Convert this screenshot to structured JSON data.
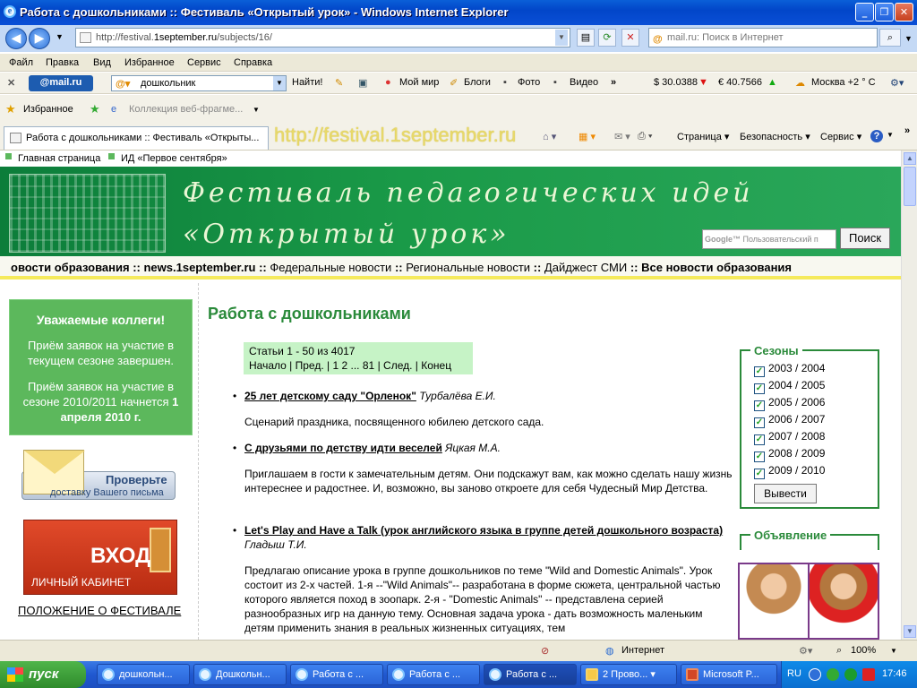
{
  "window": {
    "title": "Работа с дошкольниками :: Фестиваль «Открытый урок» - Windows Internet Explorer"
  },
  "address": {
    "url_prefix": "http://festival.",
    "url_domain": "1september.ru",
    "url_path": "/subjects/16/",
    "search_placeholder": "mail.ru: Поиск в Интернет"
  },
  "menu": [
    "Файл",
    "Правка",
    "Вид",
    "Избранное",
    "Сервис",
    "Справка"
  ],
  "mailbar": {
    "logo": "@mail.ru",
    "query": "дошкольник",
    "find": "Найти!",
    "links": [
      "Мой мир",
      "Блоги",
      "Фото",
      "Видео"
    ],
    "usd": "$ 30.0388",
    "eur": "€ 40.7566",
    "weather": "Москва +2 ° C"
  },
  "favbar": {
    "favorites": "Избранное",
    "gallery": "Коллекция веб-фрагме..."
  },
  "tabs": {
    "active_tab": "Работа с дошкольниками :: Фестиваль «Открыты...",
    "overlay_url": "http://festival.1september.ru",
    "commands": [
      "Страница",
      "Безопасность",
      "Сервис"
    ]
  },
  "page": {
    "topnav": [
      "Главная страница",
      "ИД «Первое сентября»"
    ],
    "banner": {
      "line1": "Фестиваль педагогических идей",
      "line2": "«Открытый урок»",
      "google_placeholder": "Пользовательский п",
      "search_button": "Поиск"
    },
    "newsbar": {
      "items": [
        "овости образования",
        "news.1september.ru",
        "Федеральные новости",
        "Региональные новости",
        "Дайджест СМИ",
        "Все новости образования"
      ],
      "sep": " :: "
    },
    "left": {
      "greeting": "Уважаемые коллеги!",
      "closed": "Приём заявок на участие в текущем сезоне завершен.",
      "next_prefix": "Приём заявок на участие в сезоне 2010/2011 начнется ",
      "next_date": "1 апреля 2010 г.",
      "envelope_l1": "Проверьте",
      "envelope_l2": "доставку Вашего письма",
      "login_title": "ВХОД",
      "login_sub": "ЛИЧНЫЙ КАБИНЕТ",
      "regulation": "ПОЛОЖЕНИЕ О ФЕСТИВАЛЕ"
    },
    "main": {
      "title": "Работа с дошкольниками",
      "pager": {
        "summary": "Статьи 1 - 50 из 4017",
        "start": "Начало",
        "prev": "Пред.",
        "current": "1",
        "next_page": "2",
        "dots": "...",
        "last_page": "81",
        "next": "След.",
        "end": "Конец"
      },
      "articles": [
        {
          "title": "25 лет детскому саду \"Орленок\"",
          "author": "Турбалёва Е.И.",
          "desc": "Сценарий праздника, посвященного юбилею детского сада."
        },
        {
          "title": "С друзьями по детству идти веселей",
          "author": "Яцкая М.А.",
          "desc": "Приглашаем в гости к замечательным детям. Они подскажут вам, как можно сделать нашу жизнь интереснее и радостнее. И, возможно, вы заново откроете для себя Чудесный Мир Детства."
        },
        {
          "title": "Let's Play and Have a Talk (урок английского языка в группе детей дошкольного возраста)",
          "author": "Гладыш Т.И.",
          "desc": "Предлагаю описание урока в группе дошкольников по теме \"Wild and Domestic Animals\". Урок состоит из 2-х частей. 1-я --\"Wild Animals\"-- разработана в форме сюжета, центральной частью которого является поход в зоопарк. 2-я - \"Domestic Animals\" -- представлена серией разнообразных игр на данную тему. Основная задача урока - дать возможность маленьким детям применить знания в реальных жизненных ситуациях, тем"
        }
      ]
    },
    "seasons": {
      "legend": "Сезоны",
      "years": [
        "2003 / 2004",
        "2004 / 2005",
        "2005 / 2006",
        "2006 / 2007",
        "2007 / 2008",
        "2008 / 2009",
        "2009 / 2010"
      ],
      "button": "Вывести"
    },
    "ad": {
      "legend": "Объявление"
    }
  },
  "status": {
    "zone": "Интернет",
    "zoom": "100%"
  },
  "taskbar": {
    "start": "пуск",
    "items": [
      "дошкольн...",
      "Дошкольн...",
      "Работа с ...",
      "Работа с ...",
      "Работа с ...",
      "2 Прово...",
      "Microsoft P..."
    ],
    "lang": "RU",
    "clock": "17:46"
  }
}
